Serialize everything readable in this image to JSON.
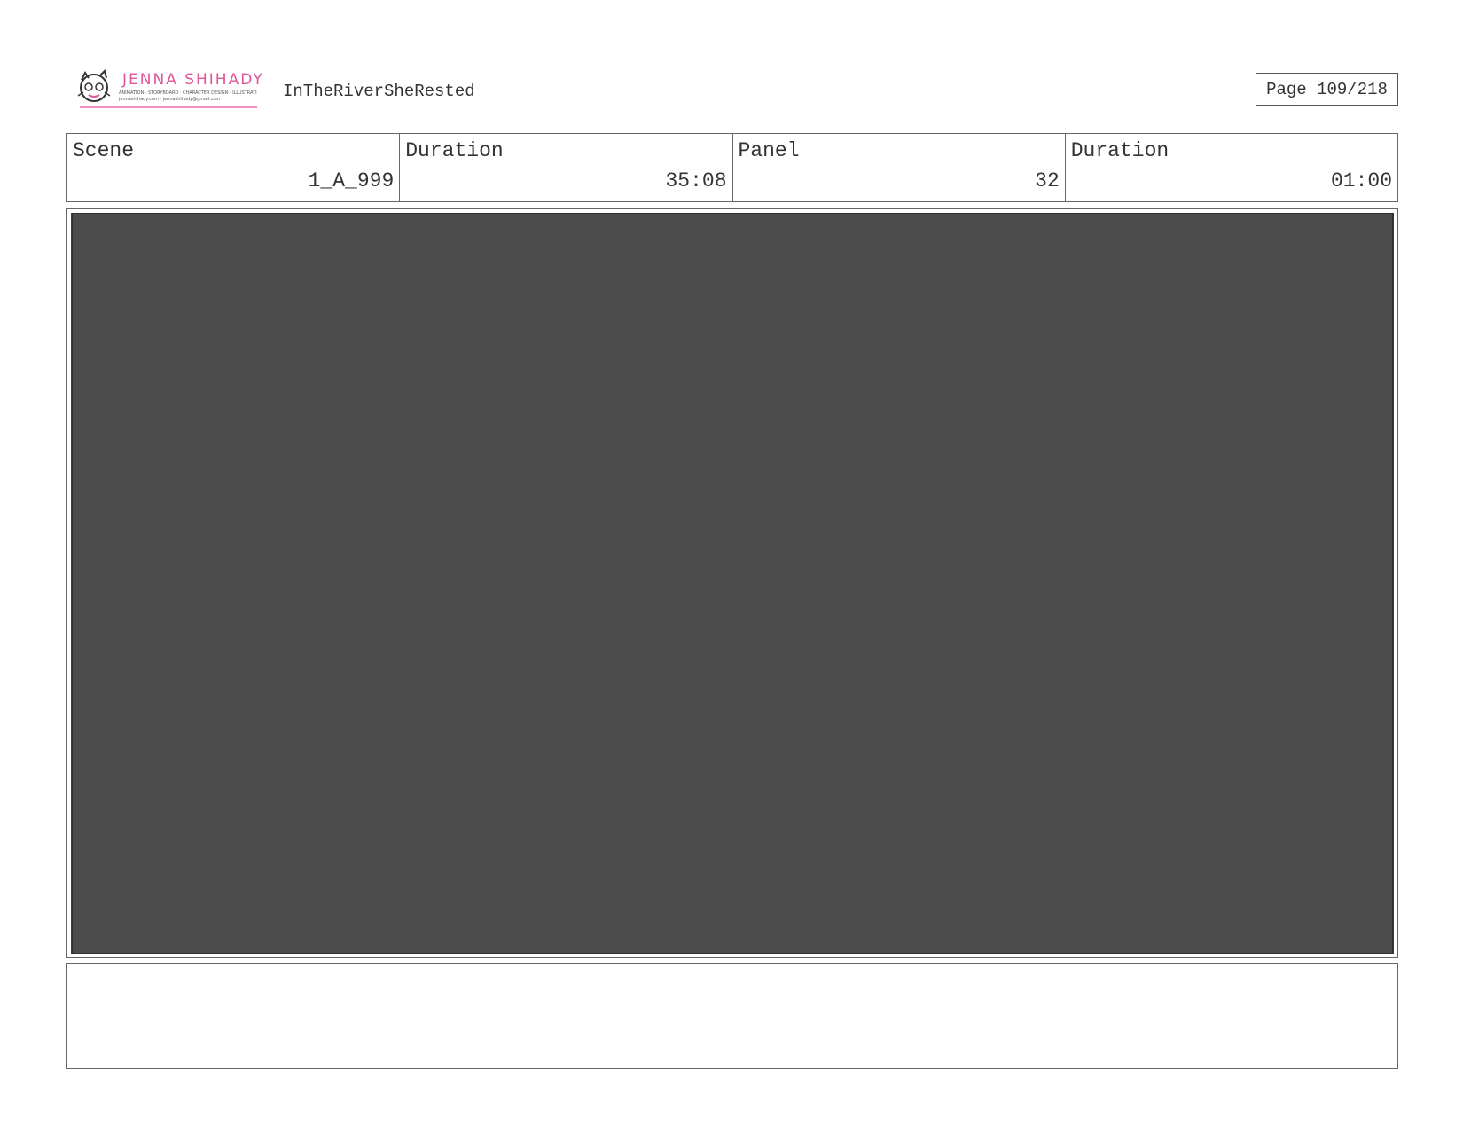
{
  "header": {
    "logo": {
      "title": "JENNA SHIHADY",
      "tagline": "ANIMATION · STORYBOARD · CHARACTER DESIGN · ILLUSTRATION",
      "contact": "jennashihady.com · jennashihady@gmail.com"
    },
    "project_title": "InTheRiverSheRested",
    "page_label": "Page 109/218"
  },
  "info": [
    {
      "label": "Scene",
      "value": "1_A_999"
    },
    {
      "label": "Duration",
      "value": "35:08"
    },
    {
      "label": "Panel",
      "value": "32"
    },
    {
      "label": "Duration",
      "value": "01:00"
    }
  ],
  "frame": {
    "fill_color": "#4c4c4c",
    "border_color": "#3e3e3e"
  },
  "notes": {
    "text": ""
  },
  "colors": {
    "logo_pink": "#e0559a",
    "underline_pink": "#ee8fbf"
  }
}
